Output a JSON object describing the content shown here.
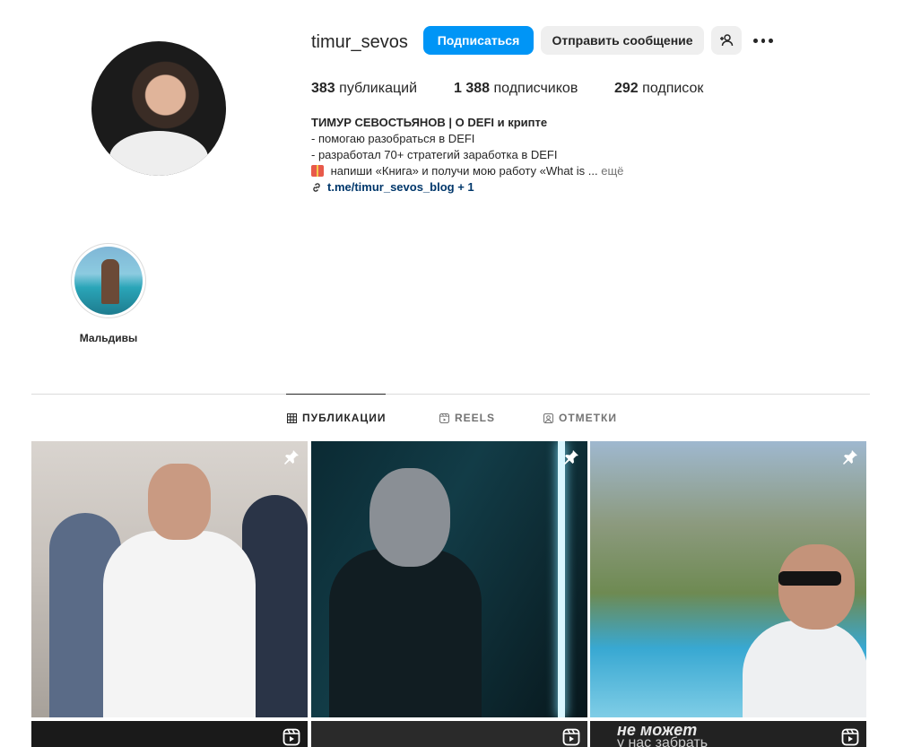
{
  "profile": {
    "username": "timur_sevos",
    "follow_label": "Подписаться",
    "message_label": "Отправить сообщение",
    "add_icon": "add-person-icon",
    "more_icon": "more-options-icon"
  },
  "stats": {
    "posts_count": "383",
    "posts_label": "публикаций",
    "followers_count": "1 388",
    "followers_label": "подписчиков",
    "following_count": "292",
    "following_label": "подписок"
  },
  "bio": {
    "name": "ТИМУР СЕВОСТЬЯНОВ | О DEFI и крипте",
    "line1": "- помогаю разобраться в DEFI",
    "line2": "- разработал 70+ стратегий заработка в DEFI",
    "line3": "напиши «Книга» и получи мою работу «What is ...",
    "more": "ещё",
    "link": "t.me/timur_sevos_blog + 1"
  },
  "highlights": [
    {
      "label": "Мальдивы"
    }
  ],
  "tabs": {
    "posts": "ПУБЛИКАЦИИ",
    "reels": "REELS",
    "tagged": "ОТМЕТКИ",
    "active": "posts"
  },
  "grid": {
    "pinned_icon": "pin-icon",
    "reel_icon": "reel-icon",
    "overlay_text_line1": "не может",
    "overlay_text_line2": "у нас забрать"
  },
  "colors": {
    "accent": "#0095f6",
    "secondary_button": "#efefef",
    "link": "#00376b",
    "muted": "#737373"
  }
}
